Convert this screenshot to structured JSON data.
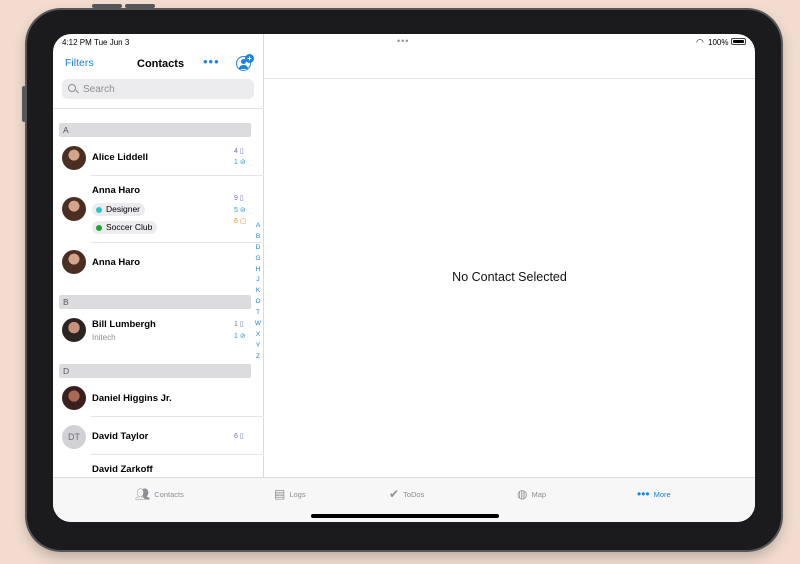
{
  "status": {
    "time": "4:12 PM",
    "date": "Tue Jun 3",
    "battery": "100%"
  },
  "sidebar": {
    "filters_label": "Filters",
    "title": "Contacts",
    "search_placeholder": "Search",
    "sections": [
      {
        "letter": "A"
      },
      {
        "letter": "B"
      },
      {
        "letter": "D"
      }
    ],
    "contacts": [
      {
        "name": "Alice Liddell",
        "initials": "",
        "subtitle": "",
        "tags": [],
        "counts": [
          {
            "n": "4",
            "kind": "logs"
          },
          {
            "n": "1",
            "kind": "todos"
          }
        ]
      },
      {
        "name": "Anna Haro",
        "initials": "",
        "subtitle": "",
        "tags": [
          {
            "label": "Designer",
            "color": "#29c5d3"
          },
          {
            "label": "Soccer Club",
            "color": "#1fa339"
          }
        ],
        "counts": [
          {
            "n": "9",
            "kind": "logs"
          },
          {
            "n": "5",
            "kind": "todos"
          },
          {
            "n": "6",
            "kind": "files"
          }
        ]
      },
      {
        "name": "Anna Haro",
        "initials": "",
        "subtitle": "",
        "tags": [],
        "counts": []
      },
      {
        "name": "Bill Lumbergh",
        "initials": "",
        "subtitle": "Initech",
        "tags": [],
        "counts": [
          {
            "n": "1",
            "kind": "logs"
          },
          {
            "n": "1",
            "kind": "todos"
          }
        ]
      },
      {
        "name": "Daniel Higgins Jr.",
        "initials": "",
        "subtitle": "",
        "tags": [],
        "counts": []
      },
      {
        "name": "David Taylor",
        "initials": "DT",
        "subtitle": "",
        "tags": [],
        "counts": [
          {
            "n": "6",
            "kind": "logs"
          }
        ]
      },
      {
        "name": "David Zarkoff",
        "initials": "",
        "subtitle": "",
        "tags": [],
        "counts": []
      }
    ],
    "index_letters": [
      "A",
      "B",
      "D",
      "G",
      "H",
      "J",
      "K",
      "O",
      "T",
      "W",
      "X",
      "Y",
      "Z"
    ]
  },
  "detail": {
    "empty_message": "No Contact Selected"
  },
  "tabbar": {
    "tabs": [
      {
        "label": "Contacts",
        "icon": "people-icon"
      },
      {
        "label": "Logs",
        "icon": "notebook-icon"
      },
      {
        "label": "ToDos",
        "icon": "checkmark-icon"
      },
      {
        "label": "Map",
        "icon": "globe-icon"
      },
      {
        "label": "More",
        "icon": "ellipsis-icon"
      }
    ],
    "active": "More"
  },
  "colors": {
    "accent": "#1a82e2",
    "logs": "#6a72b8",
    "todos": "#29a2b8",
    "files": "#e58a2e"
  }
}
